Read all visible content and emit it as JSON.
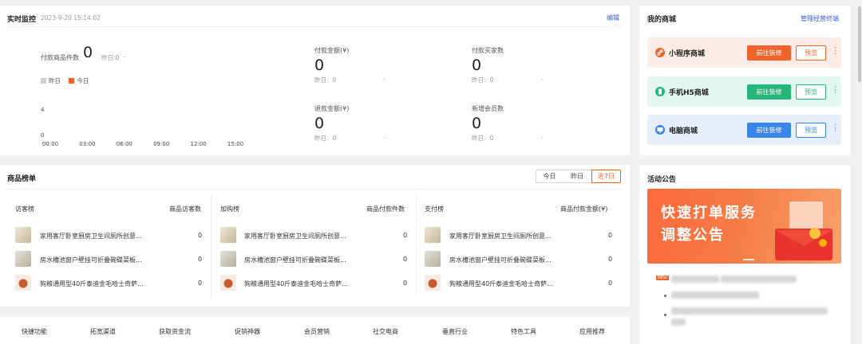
{
  "realtime": {
    "title": "实时监控",
    "timestamp": "2023-9-20 15:14:02",
    "edit_label": "编辑",
    "paid_items": {
      "label": "付款商品件数",
      "value": "0",
      "yesterday": "昨日:0",
      "dash": "-"
    },
    "legend": {
      "yesterday": "昨日",
      "today": "今日"
    },
    "chart_data": {
      "type": "line",
      "x": [
        "00:00",
        "03:00",
        "06:00",
        "09:00",
        "12:00",
        "15:00"
      ],
      "yticks": [
        "4",
        "0"
      ],
      "series": [],
      "legend": [
        "昨日",
        "今日"
      ],
      "legend_placement": "top-left",
      "colors": {
        "yesterday": "#cfcfcf",
        "today": "#f0632b"
      }
    },
    "stats": [
      {
        "label": "付款金额(¥)",
        "value": "0",
        "yesterday": "昨日：0",
        "dash": "-"
      },
      {
        "label": "付款买家数",
        "value": "0",
        "yesterday": "昨日：0",
        "dash": "-"
      },
      {
        "label": "退款金额(¥)",
        "value": "0",
        "yesterday": "昨日：0",
        "dash": "-"
      },
      {
        "label": "新增会员数",
        "value": "0",
        "yesterday": "昨日：0",
        "dash": "-"
      }
    ]
  },
  "mall": {
    "title": "我的商城",
    "manage_link": "管理经营终端",
    "cards": [
      {
        "name": "小程序商城",
        "go": "前往装修",
        "preview": "预览",
        "more": "⋮",
        "bg": "#fdebe5",
        "accent": "#f0632b",
        "icon": "link-icon"
      },
      {
        "name": "手机H5商城",
        "go": "前往装修",
        "preview": "预览",
        "more": "⋮",
        "bg": "#e2f7ef",
        "accent": "#27b57a",
        "icon": "mobile-icon"
      },
      {
        "name": "电脑商城",
        "go": "前往装修",
        "preview": "预览",
        "more": "⋮",
        "bg": "#e6edfb",
        "accent": "#3a86e8",
        "icon": "monitor-icon"
      }
    ]
  },
  "ranking": {
    "title": "商品榜单",
    "periods": [
      "今日",
      "昨日",
      "近7日"
    ],
    "active_period": "近7日",
    "columns": [
      {
        "name": "访客榜",
        "metric": "商品访客数",
        "rows": [
          {
            "name": "家用客厅卧室厨房卫生间厕所创意...",
            "value": "0"
          },
          {
            "name": "房水槽池窗户壁挂可折叠碗碟菜板...",
            "value": "0"
          },
          {
            "name": "狗粮通用型40斤泰迪金毛哈士奇萨...",
            "value": "0"
          }
        ]
      },
      {
        "name": "加购榜",
        "metric": "商品付款件数",
        "rows": [
          {
            "name": "家用客厅卧室厨房卫生间厕所创意...",
            "value": "0"
          },
          {
            "name": "房水槽池窗户壁挂可折叠碗碟菜板...",
            "value": "0"
          },
          {
            "name": "狗粮通用型40斤泰迪金毛哈士奇萨...",
            "value": "0"
          }
        ]
      },
      {
        "name": "支付榜",
        "metric": "商品付款金额(¥)",
        "rows": [
          {
            "name": "家用客厅卧室厨房卫生间厕所创意...",
            "value": "0"
          },
          {
            "name": "房水槽池窗户壁挂可折叠碗碟菜板...",
            "value": "0"
          },
          {
            "name": "狗粮通用型40斤泰迪金毛哈士奇萨...",
            "value": "0"
          }
        ]
      }
    ]
  },
  "bottom_nav": [
    "快捷功能",
    "拓宽渠道",
    "获取资金流",
    "促销神器",
    "会员营销",
    "社交电商",
    "垂直行业",
    "特色工具",
    "应用推荐"
  ],
  "announcement": {
    "title": "活动公告",
    "banner_line1": "快速打单服务",
    "banner_line2": "调整公告",
    "new_badge": "NEW"
  }
}
